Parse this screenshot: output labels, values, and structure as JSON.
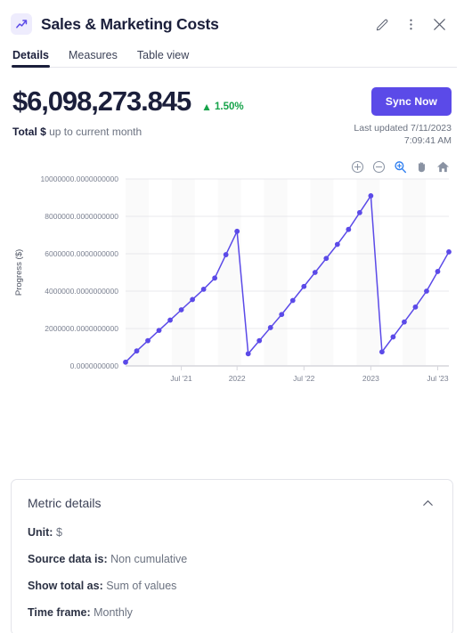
{
  "header": {
    "title": "Sales & Marketing Costs",
    "icon": "trend-up-icon",
    "edit_label": "Edit",
    "more_label": "More options",
    "close_label": "Close"
  },
  "tabs": [
    {
      "label": "Details",
      "active": true
    },
    {
      "label": "Measures",
      "active": false
    },
    {
      "label": "Table view",
      "active": false
    }
  ],
  "kpi": {
    "value": "$6,098,273.845",
    "delta": "1.50%",
    "delta_direction": "up",
    "delta_color": "#16a34a",
    "subtitle_strong": "Total $",
    "subtitle_rest": " up to current month",
    "sync_label": "Sync Now",
    "sync_color": "#5b4ae8",
    "updated_line1": "Last updated 7/11/2023",
    "updated_line2": "7:09:41 AM"
  },
  "chart_toolbar": [
    {
      "name": "zoom-in-circle-icon",
      "active": false
    },
    {
      "name": "zoom-out-circle-icon",
      "active": false
    },
    {
      "name": "magnifier-icon",
      "active": true
    },
    {
      "name": "pan-hand-icon",
      "active": false
    },
    {
      "name": "home-reset-icon",
      "active": false
    }
  ],
  "chart_data": {
    "type": "line",
    "title": "",
    "xlabel": "",
    "ylabel": "Progress ($)",
    "series_color": "#5b4ae8",
    "grid": true,
    "legend": false,
    "ylim": [
      0,
      10000000
    ],
    "ytick_labels": [
      "0.0000000000",
      "2000000.0000000000",
      "4000000.0000000000",
      "6000000.0000000000",
      "8000000.0000000000",
      "10000000.0000000000"
    ],
    "ytick_values": [
      0,
      2000000,
      4000000,
      6000000,
      8000000,
      10000000
    ],
    "xtick_labels": [
      "Jul '21",
      "2022",
      "Jul '22",
      "2023",
      "Jul '23"
    ],
    "xtick_index": [
      5,
      10,
      16,
      22,
      28
    ],
    "x": [
      "Feb '21",
      "Mar '21",
      "Apr '21",
      "May '21",
      "Jun '21",
      "Jul '21",
      "Aug '21",
      "Sep '21",
      "Oct '21",
      "Nov '21",
      "Dec '21",
      "Jan '22",
      "Feb '22",
      "Mar '22",
      "Apr '22",
      "May '22",
      "Jun '22",
      "Jul '22",
      "Aug '22",
      "Sep '22",
      "Oct '22",
      "Nov '22",
      "Dec '22",
      "Jan '23",
      "Feb '23",
      "Mar '23",
      "Apr '23",
      "May '23",
      "Jun '23",
      "Jul '23"
    ],
    "values": [
      200000,
      800000,
      1350000,
      1900000,
      2450000,
      3000000,
      3550000,
      4100000,
      4700000,
      5950000,
      7200000,
      650000,
      1350000,
      2050000,
      2750000,
      3500000,
      4250000,
      5000000,
      5750000,
      6500000,
      7300000,
      8200000,
      9100000,
      750000,
      1550000,
      2350000,
      3150000,
      4000000,
      5050000,
      6098273.845
    ]
  },
  "metric_details": {
    "title": "Metric details",
    "collapse_icon": "chevron-up-icon",
    "rows": [
      {
        "label": "Unit:",
        "value": " $"
      },
      {
        "label": "Source data is:",
        "value": " Non cumulative"
      },
      {
        "label": "Show total as:",
        "value": " Sum of values"
      },
      {
        "label": "Time frame:",
        "value": " Monthly"
      }
    ]
  }
}
